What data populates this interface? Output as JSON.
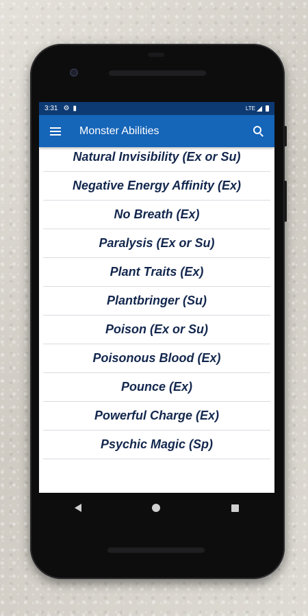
{
  "status_bar": {
    "time": "3:31",
    "network": "LTE"
  },
  "app_bar": {
    "title": "Monster Abilities"
  },
  "abilities": [
    "Natural Invisibility (Ex or Su)",
    "Negative Energy Affinity (Ex)",
    "No Breath (Ex)",
    "Paralysis (Ex or Su)",
    "Plant Traits (Ex)",
    "Plantbringer (Su)",
    "Poison (Ex or Su)",
    "Poisonous Blood (Ex)",
    "Pounce (Ex)",
    "Powerful Charge (Ex)",
    "Psychic Magic (Sp)"
  ],
  "colors": {
    "app_bar": "#1565b8",
    "status_bar": "#0e3a73",
    "item_text": "#13274d"
  },
  "icons": {
    "menu": "hamburger-menu-icon",
    "search": "search-icon",
    "settings": "gear-icon",
    "sd": "sd-card-icon"
  }
}
